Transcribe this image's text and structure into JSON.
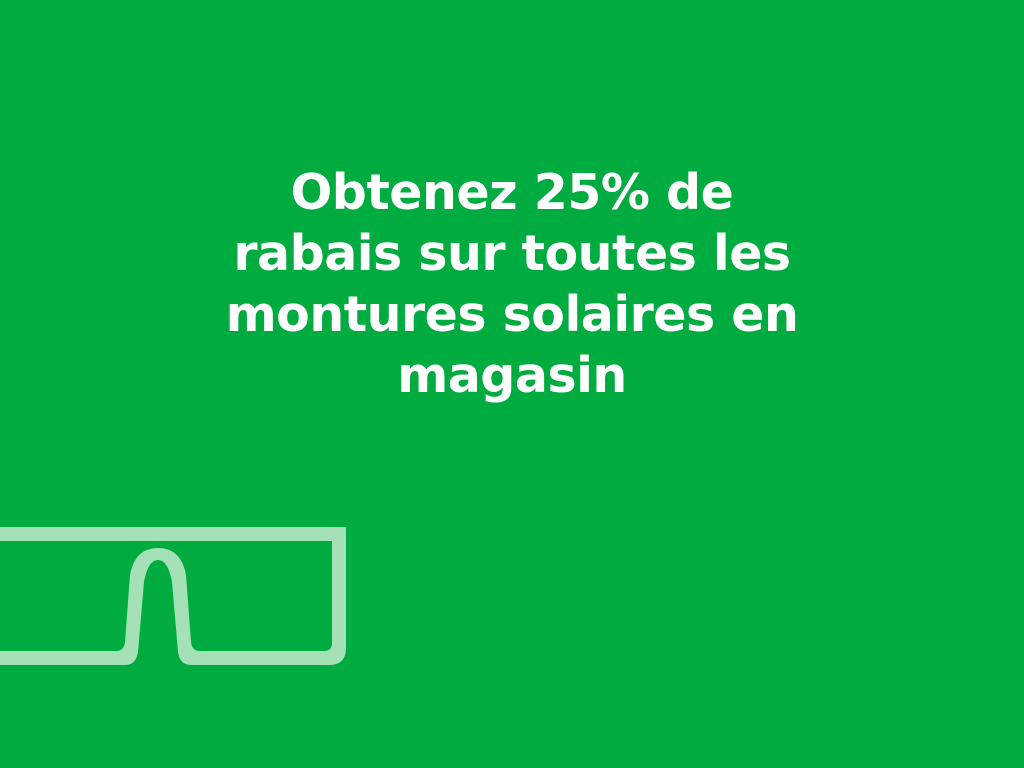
{
  "promo": {
    "lines": [
      "Obtenez 25% de",
      "rabais sur toutes les",
      "montures solaires en",
      "magasin"
    ]
  },
  "colors": {
    "background": "#00ab3f",
    "text": "#ffffff",
    "glasses": "#a4e1b6"
  },
  "icons": {
    "glasses": "glasses-icon"
  }
}
